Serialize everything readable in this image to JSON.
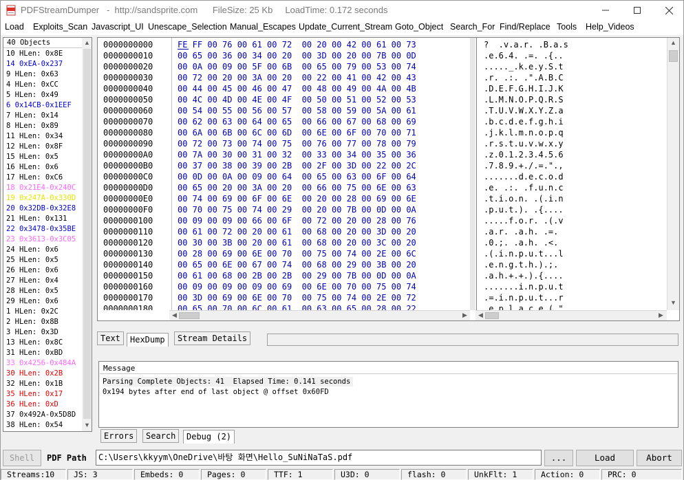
{
  "window": {
    "title": "PDFStreamDumper   -  http://sandsprite.com      FileSize: 25 Kb     LoadTime: 0.172 seconds"
  },
  "menu": [
    "Load",
    "Exploits_Scan",
    "Javascript_UI",
    "Unescape_Selection",
    "Manual_Escapes",
    "Update_Current_Stream",
    "Goto_Object",
    "Search_For",
    "Find/Replace",
    "Tools",
    "Help_Videos"
  ],
  "objects": {
    "header": "40 Objects",
    "rows": [
      {
        "text": "10 HLen: 0x8E",
        "color": "#000000"
      },
      {
        "text": "14 0xEA-0x237",
        "color": "#0000cc"
      },
      {
        "text": "9 HLen: 0x63",
        "color": "#000000"
      },
      {
        "text": "4 HLen: 0xCC",
        "color": "#000000"
      },
      {
        "text": "5 HLen: 0x49",
        "color": "#000000"
      },
      {
        "text": "6 0x14CB-0x1EEF",
        "color": "#0000cc"
      },
      {
        "text": "7 HLen: 0x14",
        "color": "#000000"
      },
      {
        "text": "8 HLen: 0x89",
        "color": "#000000"
      },
      {
        "text": "11 HLen: 0x34",
        "color": "#000000"
      },
      {
        "text": "12 HLen: 0x8F",
        "color": "#000000"
      },
      {
        "text": "15 HLen: 0x5",
        "color": "#000000"
      },
      {
        "text": "16 HLen: 0x6",
        "color": "#000000"
      },
      {
        "text": "17 HLen: 0xC6",
        "color": "#000000"
      },
      {
        "text": "18 0x21E4-0x240C",
        "color": "#ff66ff"
      },
      {
        "text": "19 0x247A-0x330D",
        "color": "#e6e600"
      },
      {
        "text": "20 0x32DB-0x32E8",
        "color": "#0000cc"
      },
      {
        "text": "21 HLen: 0x131",
        "color": "#000000"
      },
      {
        "text": "22 0x3478-0x35BE",
        "color": "#0000cc"
      },
      {
        "text": "23 0x3613-0x3C05",
        "color": "#ff66ff"
      },
      {
        "text": "24 HLen: 0x6",
        "color": "#000000"
      },
      {
        "text": "25 HLen: 0x5",
        "color": "#000000"
      },
      {
        "text": "26 HLen: 0x6",
        "color": "#000000"
      },
      {
        "text": "27 HLen: 0x4",
        "color": "#000000"
      },
      {
        "text": "28 HLen: 0x5",
        "color": "#000000"
      },
      {
        "text": "29 HLen: 0x6",
        "color": "#000000"
      },
      {
        "text": "1 HLen: 0x2C",
        "color": "#000000"
      },
      {
        "text": "2 HLen: 0x8B",
        "color": "#000000"
      },
      {
        "text": "3 HLen: 0x3D",
        "color": "#000000"
      },
      {
        "text": "13 HLen: 0x8C",
        "color": "#000000"
      },
      {
        "text": "31 HLen: 0xBD",
        "color": "#000000"
      },
      {
        "text": "33 0x4256-0x484A",
        "color": "#ff66ff"
      },
      {
        "text": "30 HLen: 0x2B",
        "color": "#dd0000"
      },
      {
        "text": "32 HLen: 0x1B",
        "color": "#000000"
      },
      {
        "text": "35 HLen: 0x17",
        "color": "#dd0000"
      },
      {
        "text": "36 HLen: 0xD",
        "color": "#dd0000"
      },
      {
        "text": "37 0x492A-0x5D8D",
        "color": "#000000"
      },
      {
        "text": "38 HLen: 0x54",
        "color": "#000000"
      }
    ]
  },
  "hex": {
    "rows": [
      {
        "addr": "0000000000",
        "bytes": "FE FF 00 76 00 61 00 72  00 20 00 42 00 61 00 73",
        "ascii": "?  .v.a.r. .B.a.s"
      },
      {
        "addr": "0000000010",
        "bytes": "00 65 00 36 00 34 00 20  00 3D 00 20 00 7B 00 0D",
        "ascii": ".e.6.4. .=. .{.."
      },
      {
        "addr": "0000000020",
        "bytes": "00 0A 00 09 00 5F 00 6B  00 65 00 79 00 53 00 74",
        "ascii": "....._.k.e.y.S.t"
      },
      {
        "addr": "0000000030",
        "bytes": "00 72 00 20 00 3A 00 20  00 22 00 41 00 42 00 43",
        "ascii": ".r. .:. .\".A.B.C"
      },
      {
        "addr": "0000000040",
        "bytes": "00 44 00 45 00 46 00 47  00 48 00 49 00 4A 00 4B",
        "ascii": ".D.E.F.G.H.I.J.K"
      },
      {
        "addr": "0000000050",
        "bytes": "00 4C 00 4D 00 4E 00 4F  00 50 00 51 00 52 00 53",
        "ascii": ".L.M.N.O.P.Q.R.S"
      },
      {
        "addr": "0000000060",
        "bytes": "00 54 00 55 00 56 00 57  00 58 00 59 00 5A 00 61",
        "ascii": ".T.U.V.W.X.Y.Z.a"
      },
      {
        "addr": "0000000070",
        "bytes": "00 62 00 63 00 64 00 65  00 66 00 67 00 68 00 69",
        "ascii": ".b.c.d.e.f.g.h.i"
      },
      {
        "addr": "0000000080",
        "bytes": "00 6A 00 6B 00 6C 00 6D  00 6E 00 6F 00 70 00 71",
        "ascii": ".j.k.l.m.n.o.p.q"
      },
      {
        "addr": "0000000090",
        "bytes": "00 72 00 73 00 74 00 75  00 76 00 77 00 78 00 79",
        "ascii": ".r.s.t.u.v.w.x.y"
      },
      {
        "addr": "00000000A0",
        "bytes": "00 7A 00 30 00 31 00 32  00 33 00 34 00 35 00 36",
        "ascii": ".z.0.1.2.3.4.5.6"
      },
      {
        "addr": "00000000B0",
        "bytes": "00 37 00 38 00 39 00 2B  00 2F 00 3D 00 22 00 2C",
        "ascii": ".7.8.9.+./.=.\".,"
      },
      {
        "addr": "00000000C0",
        "bytes": "00 0D 00 0A 00 09 00 64  00 65 00 63 00 6F 00 64",
        "ascii": ".......d.e.c.o.d"
      },
      {
        "addr": "00000000D0",
        "bytes": "00 65 00 20 00 3A 00 20  00 66 00 75 00 6E 00 63",
        "ascii": ".e. .:. .f.u.n.c"
      },
      {
        "addr": "00000000E0",
        "bytes": "00 74 00 69 00 6F 00 6E  00 20 00 28 00 69 00 6E",
        "ascii": ".t.i.o.n. .(.i.n"
      },
      {
        "addr": "00000000F0",
        "bytes": "00 70 00 75 00 74 00 29  00 20 00 7B 00 0D 00 0A",
        "ascii": ".p.u.t.). .{...."
      },
      {
        "addr": "0000000100",
        "bytes": "00 09 00 09 00 66 00 6F  00 72 00 20 00 28 00 76",
        "ascii": ".....f.o.r. .(.v"
      },
      {
        "addr": "0000000110",
        "bytes": "00 61 00 72 00 20 00 61  00 68 00 20 00 3D 00 20",
        "ascii": ".a.r. .a.h. .=. "
      },
      {
        "addr": "0000000120",
        "bytes": "00 30 00 3B 00 20 00 61  00 68 00 20 00 3C 00 20",
        "ascii": ".0.;. .a.h. .<. "
      },
      {
        "addr": "0000000130",
        "bytes": "00 28 00 69 00 6E 00 70  00 75 00 74 00 2E 00 6C",
        "ascii": ".(.i.n.p.u.t...l"
      },
      {
        "addr": "0000000140",
        "bytes": "00 65 00 6E 00 67 00 74  00 68 00 29 00 3B 00 20",
        "ascii": ".e.n.g.t.h.).;. "
      },
      {
        "addr": "0000000150",
        "bytes": "00 61 00 68 00 2B 00 2B  00 29 00 7B 00 0D 00 0A",
        "ascii": ".a.h.+.+.).{...."
      },
      {
        "addr": "0000000160",
        "bytes": "00 09 00 09 00 09 00 69  00 6E 00 70 00 75 00 74",
        "ascii": ".......i.n.p.u.t"
      },
      {
        "addr": "0000000170",
        "bytes": "00 3D 00 69 00 6E 00 70  00 75 00 74 00 2E 00 72",
        "ascii": ".=.i.n.p.u.t...r"
      },
      {
        "addr": "0000000180",
        "bytes": "00 65 00 70 00 6C 00 61  00 63 00 65 00 28 00 22",
        "ascii": ".e.p.l.a.c.e.(.\""
      },
      {
        "addr": "0000000190",
        "bytes": "",
        "ascii": ""
      }
    ]
  },
  "tabs_top": {
    "text": "Text",
    "hexdump": "HexDump",
    "stream_details": "Stream Details"
  },
  "message": {
    "header": "Message",
    "lines": [
      "Parsing Complete Objects: 41  Elapsed Time: 0.141 seconds",
      "0x194 bytes after end of last object @ offset 0x60FD"
    ]
  },
  "tabs_bottom": {
    "errors": "Errors",
    "search": "Search",
    "debug": "Debug (2)"
  },
  "controls": {
    "shell": "Shell",
    "pdf_path_label": "PDF Path",
    "pdf_path": "C:\\Users\\kkyym\\OneDrive\\바탕 화면\\Hello_SuNiNaTaS.pdf",
    "browse": "...",
    "load": "Load",
    "abort": "Abort"
  },
  "status": {
    "streams": "Streams:10",
    "js": "JS: 3",
    "embeds": "Embeds: 0",
    "pages": "Pages: 0",
    "ttf": "TTF: 1",
    "u3d": "U3D: 0",
    "flash": "flash: 0",
    "unkflt": "UnkFlt: 1",
    "action": "Action: 0",
    "prc": "PRC: 0"
  },
  "colors": {
    "hex_bytes": "#0000b4",
    "selection_red": "#dd0000",
    "pink": "#ff66ff",
    "yellow": "#e6e600",
    "blue": "#0000cc"
  },
  "icons": {
    "app": "pdf-icon",
    "minimize": "minimize-icon",
    "maximize": "maximize-icon",
    "close": "close-icon"
  }
}
